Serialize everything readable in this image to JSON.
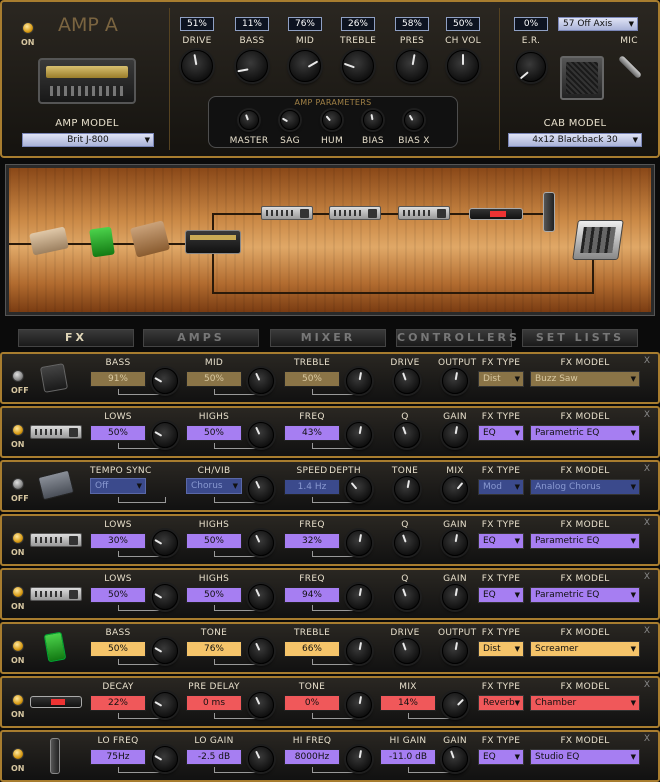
{
  "amp": {
    "power_label": "ON",
    "title": "AMP A",
    "model_label": "AMP MODEL",
    "model_value": "Brit J-800",
    "knobs": [
      {
        "label": "DRIVE",
        "value": "51%"
      },
      {
        "label": "BASS",
        "value": "11%"
      },
      {
        "label": "MID",
        "value": "76%"
      },
      {
        "label": "TREBLE",
        "value": "26%"
      },
      {
        "label": "PRES",
        "value": "58%"
      },
      {
        "label": "CH VOL",
        "value": "50%"
      }
    ],
    "params_title": "AMP PARAMETERS",
    "params": [
      "MASTER",
      "SAG",
      "HUM",
      "BIAS",
      "BIAS X"
    ],
    "er_label": "E.R.",
    "er_value": "0%",
    "mic_label": "MIC",
    "mic_value": "57 Off Axis",
    "cab_label": "CAB MODEL",
    "cab_value": "4x12 Blackback 30"
  },
  "tabs": [
    "FX",
    "AMPS",
    "MIXER",
    "CONTROLLERS",
    "SET LISTS"
  ],
  "fx_type_label": "FX TYPE",
  "fx_model_label": "FX MODEL",
  "close_glyph": "X",
  "rows": [
    {
      "power": "OFF",
      "on": false,
      "icon": "wah-pedal-icon",
      "labels": [
        "BASS",
        "MID",
        "TREBLE",
        "DRIVE",
        "OUTPUT"
      ],
      "values": [
        "91%",
        "50%",
        "50%"
      ],
      "type": "Dist",
      "model": "Buzz Saw",
      "color": "#8a7447",
      "text": "#d8c8a0"
    },
    {
      "power": "ON",
      "on": true,
      "icon": "parametric-eq-icon",
      "labels": [
        "LOWS",
        "HIGHS",
        "FREQ",
        "Q",
        "GAIN"
      ],
      "values": [
        "50%",
        "50%",
        "43%"
      ],
      "type": "EQ",
      "model": "Parametric EQ",
      "color": "#a67ef2",
      "text": "#111"
    },
    {
      "power": "OFF",
      "on": false,
      "icon": "chorus-pedal-icon",
      "labels": [
        "TEMPO SYNC",
        "CH/VIB",
        "SPEED",
        "DEPTH",
        "TONE",
        "MIX"
      ],
      "values": [
        "Off",
        "Chorus",
        "1.4 Hz"
      ],
      "type": "Mod",
      "model": "Analog Chorus",
      "color": "#3b4a8c",
      "text": "#8898d0"
    },
    {
      "power": "ON",
      "on": true,
      "icon": "parametric-eq-icon",
      "labels": [
        "LOWS",
        "HIGHS",
        "FREQ",
        "Q",
        "GAIN"
      ],
      "values": [
        "30%",
        "50%",
        "32%"
      ],
      "type": "EQ",
      "model": "Parametric EQ",
      "color": "#a67ef2",
      "text": "#111"
    },
    {
      "power": "ON",
      "on": true,
      "icon": "parametric-eq-icon",
      "labels": [
        "LOWS",
        "HIGHS",
        "FREQ",
        "Q",
        "GAIN"
      ],
      "values": [
        "50%",
        "50%",
        "94%"
      ],
      "type": "EQ",
      "model": "Parametric EQ",
      "color": "#a67ef2",
      "text": "#111"
    },
    {
      "power": "ON",
      "on": true,
      "icon": "screamer-pedal-icon",
      "labels": [
        "BASS",
        "TONE",
        "TREBLE",
        "DRIVE",
        "OUTPUT"
      ],
      "values": [
        "50%",
        "76%",
        "66%"
      ],
      "type": "Dist",
      "model": "Screamer",
      "color": "#f5c46a",
      "text": "#111"
    },
    {
      "power": "ON",
      "on": true,
      "icon": "reverb-rack-icon",
      "labels": [
        "DECAY",
        "PRE DELAY",
        "TONE",
        "MIX"
      ],
      "values": [
        "22%",
        "0 ms",
        "0%",
        "14%"
      ],
      "type": "Reverb",
      "model": "Chamber",
      "color": "#f0585a",
      "text": "#111"
    },
    {
      "power": "ON",
      "on": true,
      "icon": "studio-eq-icon",
      "labels": [
        "LO FREQ",
        "LO GAIN",
        "HI FREQ",
        "HI GAIN",
        "GAIN"
      ],
      "values": [
        "75Hz",
        "-2.5 dB",
        "8000Hz",
        "-11.0 dB"
      ],
      "type": "EQ",
      "model": "Studio EQ",
      "color": "#a67ef2",
      "text": "#111"
    }
  ]
}
